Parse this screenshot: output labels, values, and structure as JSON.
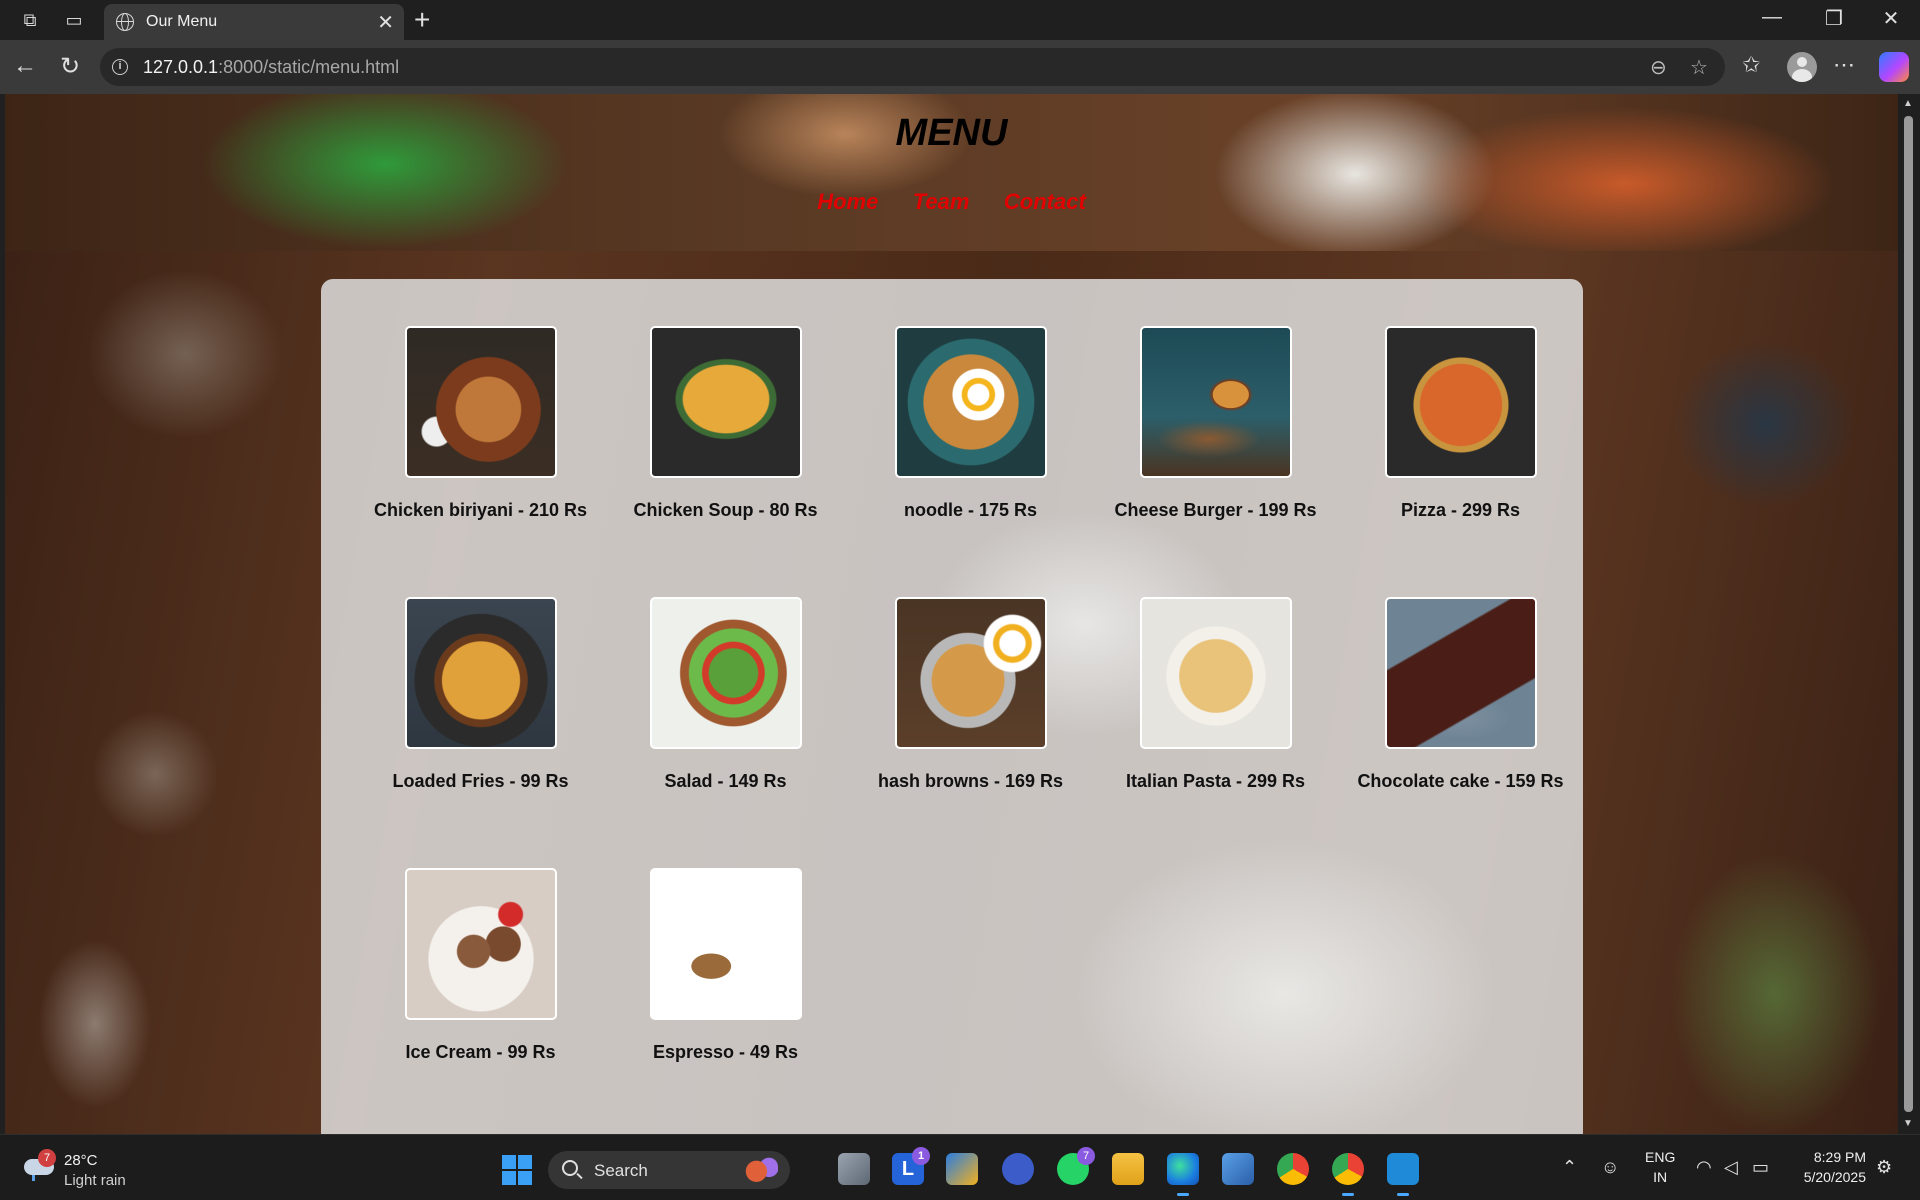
{
  "browser": {
    "tab_title": "Our Menu",
    "url_host": "127.0.0.1",
    "url_rest": ":8000/static/menu.html"
  },
  "page": {
    "title": "MENU",
    "nav": [
      "Home",
      "Team",
      "Contact"
    ],
    "link_color": "#e30000"
  },
  "menu_items": [
    {
      "label": "Chicken biriyani - 210 Rs",
      "thumb": "t-biriyani"
    },
    {
      "label": "Chicken Soup - 80 Rs",
      "thumb": "t-soup"
    },
    {
      "label": "noodle - 175 Rs",
      "thumb": "t-noodle"
    },
    {
      "label": "Cheese Burger - 199 Rs",
      "thumb": "t-burger"
    },
    {
      "label": "Pizza - 299 Rs",
      "thumb": "t-pizza"
    },
    {
      "label": "Loaded Fries - 99 Rs",
      "thumb": "t-fries"
    },
    {
      "label": "Salad - 149 Rs",
      "thumb": "t-salad"
    },
    {
      "label": "hash browns - 169 Rs",
      "thumb": "t-hash"
    },
    {
      "label": "Italian Pasta - 299 Rs",
      "thumb": "t-pasta"
    },
    {
      "label": "Chocolate cake - 159 Rs",
      "thumb": "t-cake"
    },
    {
      "label": "Ice Cream - 99 Rs",
      "thumb": "t-icecream"
    },
    {
      "label": "Espresso - 49 Rs",
      "thumb": "t-espresso"
    }
  ],
  "taskbar": {
    "weather_temp": "28°C",
    "weather_desc": "Light rain",
    "weather_badge": "7",
    "search_label": "Search",
    "lang_line1": "ENG",
    "lang_line2": "IN",
    "time": "8:29 PM",
    "date": "5/20/2025",
    "badge_l": "1",
    "badge_whatsapp": "7"
  }
}
